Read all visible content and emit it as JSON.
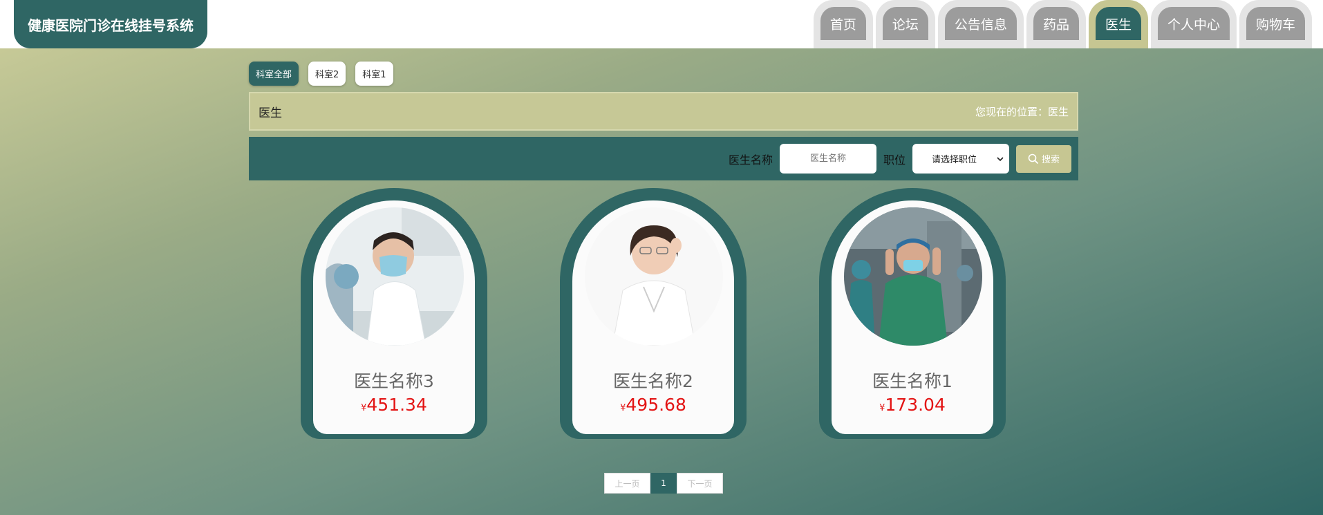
{
  "header": {
    "title": "健康医院门诊在线挂号系统"
  },
  "nav": [
    {
      "label": "首页"
    },
    {
      "label": "论坛"
    },
    {
      "label": "公告信息"
    },
    {
      "label": "药品"
    },
    {
      "label": "医生",
      "active": true
    },
    {
      "label": "个人中心"
    },
    {
      "label": "购物车"
    }
  ],
  "categories": [
    "科室全部",
    "科室2",
    "科室1"
  ],
  "breadcrumb": {
    "title": "医生",
    "location": "您现在的位置：医生"
  },
  "search": {
    "name_label": "医生名称",
    "name_placeholder": "医生名称",
    "position_label": "职位",
    "position_selected": "请选择职位",
    "button_label": "搜索"
  },
  "doctors": [
    {
      "name": "医生名称3",
      "currency": "¥",
      "price": "451.34"
    },
    {
      "name": "医生名称2",
      "currency": "¥",
      "price": "495.68"
    },
    {
      "name": "医生名称1",
      "currency": "¥",
      "price": "173.04"
    }
  ],
  "pagination": {
    "prev": "上一页",
    "current": "1",
    "next": "下一页"
  },
  "colors": {
    "primary": "#2f6664",
    "accent": "#c6c692",
    "price": "#e31414"
  }
}
